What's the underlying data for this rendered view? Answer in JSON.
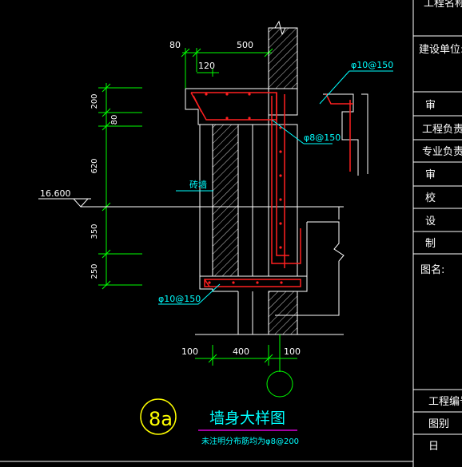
{
  "title_block": {
    "project_name_partial": "工程名称",
    "construction_unit": "建设单位:",
    "rows": [
      "审",
      "工程负责",
      "专业负责",
      "审",
      "校",
      "设",
      "制"
    ],
    "drawing_name": "图名:",
    "project_no": "工程编号",
    "drawing_type": "图别",
    "date": "日"
  },
  "drawing": {
    "detail_no": "8a",
    "title": "墙身大样图",
    "note": "未注明分布筋均为φ8@200",
    "elevation": "16.600",
    "dims_top": [
      "80",
      "500",
      "120"
    ],
    "dims_left": [
      "200",
      "80",
      "620",
      "350",
      "250"
    ],
    "dims_bottom": [
      "100",
      "400",
      "100"
    ],
    "rebar_labels": [
      "φ10@150",
      "φ8@150",
      "φ10@150"
    ],
    "wall_label": "砖墙"
  },
  "colors": {
    "background": "#000000",
    "frame": "#ffffff",
    "dimension": "#00ff00",
    "rebar": "#ff2020",
    "label": "#00ffff",
    "title": "#ff00ff",
    "circle": "#ffff00"
  }
}
